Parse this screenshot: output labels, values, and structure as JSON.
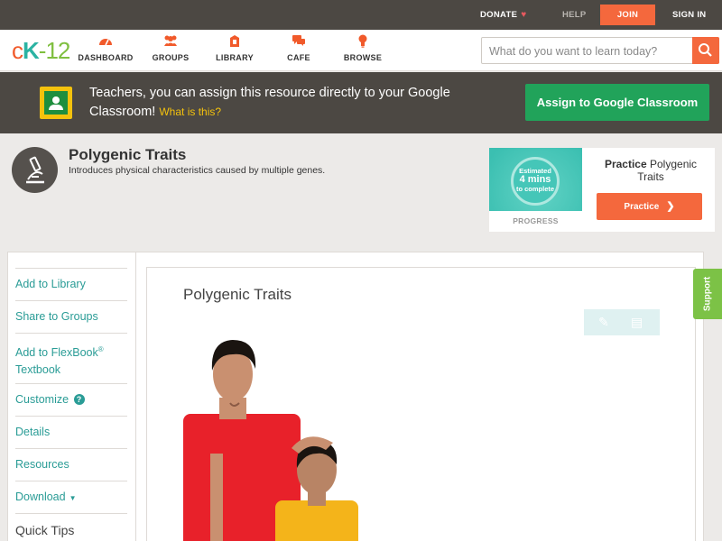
{
  "topbar": {
    "donate": "DONATE",
    "help": "HELP",
    "join": "JOIN",
    "signin": "SIGN IN"
  },
  "nav": {
    "logo_c": "c",
    "logo_k": "K",
    "logo_rest": "-12",
    "items": [
      {
        "label": "DASHBOARD",
        "icon": "dashboard-icon"
      },
      {
        "label": "GROUPS",
        "icon": "groups-icon"
      },
      {
        "label": "LIBRARY",
        "icon": "library-icon"
      },
      {
        "label": "CAFE",
        "icon": "cafe-icon"
      },
      {
        "label": "BROWSE",
        "icon": "browse-icon"
      }
    ],
    "search_placeholder": "What do you want to learn today?"
  },
  "banner": {
    "text": "Teachers, you can assign this resource directly to your Google Classroom!",
    "what_link": "What is this?",
    "assign_button": "Assign to Google Classroom"
  },
  "concept": {
    "title": "Polygenic Traits",
    "description": "Introduces physical characteristics caused by multiple genes."
  },
  "practice": {
    "estimated_line1": "Estimated",
    "minutes": "4 mins",
    "estimated_line3": "to complete",
    "progress_label": "PROGRESS",
    "title_bold": "Practice",
    "title_rest": "Polygenic Traits",
    "button": "Practice"
  },
  "sidebar": {
    "add_to_library": "Add to Library",
    "share_to_groups": "Share to Groups",
    "add_to_flexbook": "Add to FlexBook",
    "flexbook_mark": "®",
    "textbook": "Textbook",
    "customize": "Customize",
    "details": "Details",
    "resources": "Resources",
    "download": "Download",
    "quick_tips": "Quick Tips"
  },
  "reader": {
    "title": "Polygenic Traits"
  },
  "support": "Support",
  "colors": {
    "accent_orange": "#f4683d",
    "teal": "#2a9c96",
    "green": "#21a35a",
    "dark_bar": "#4c4843"
  }
}
